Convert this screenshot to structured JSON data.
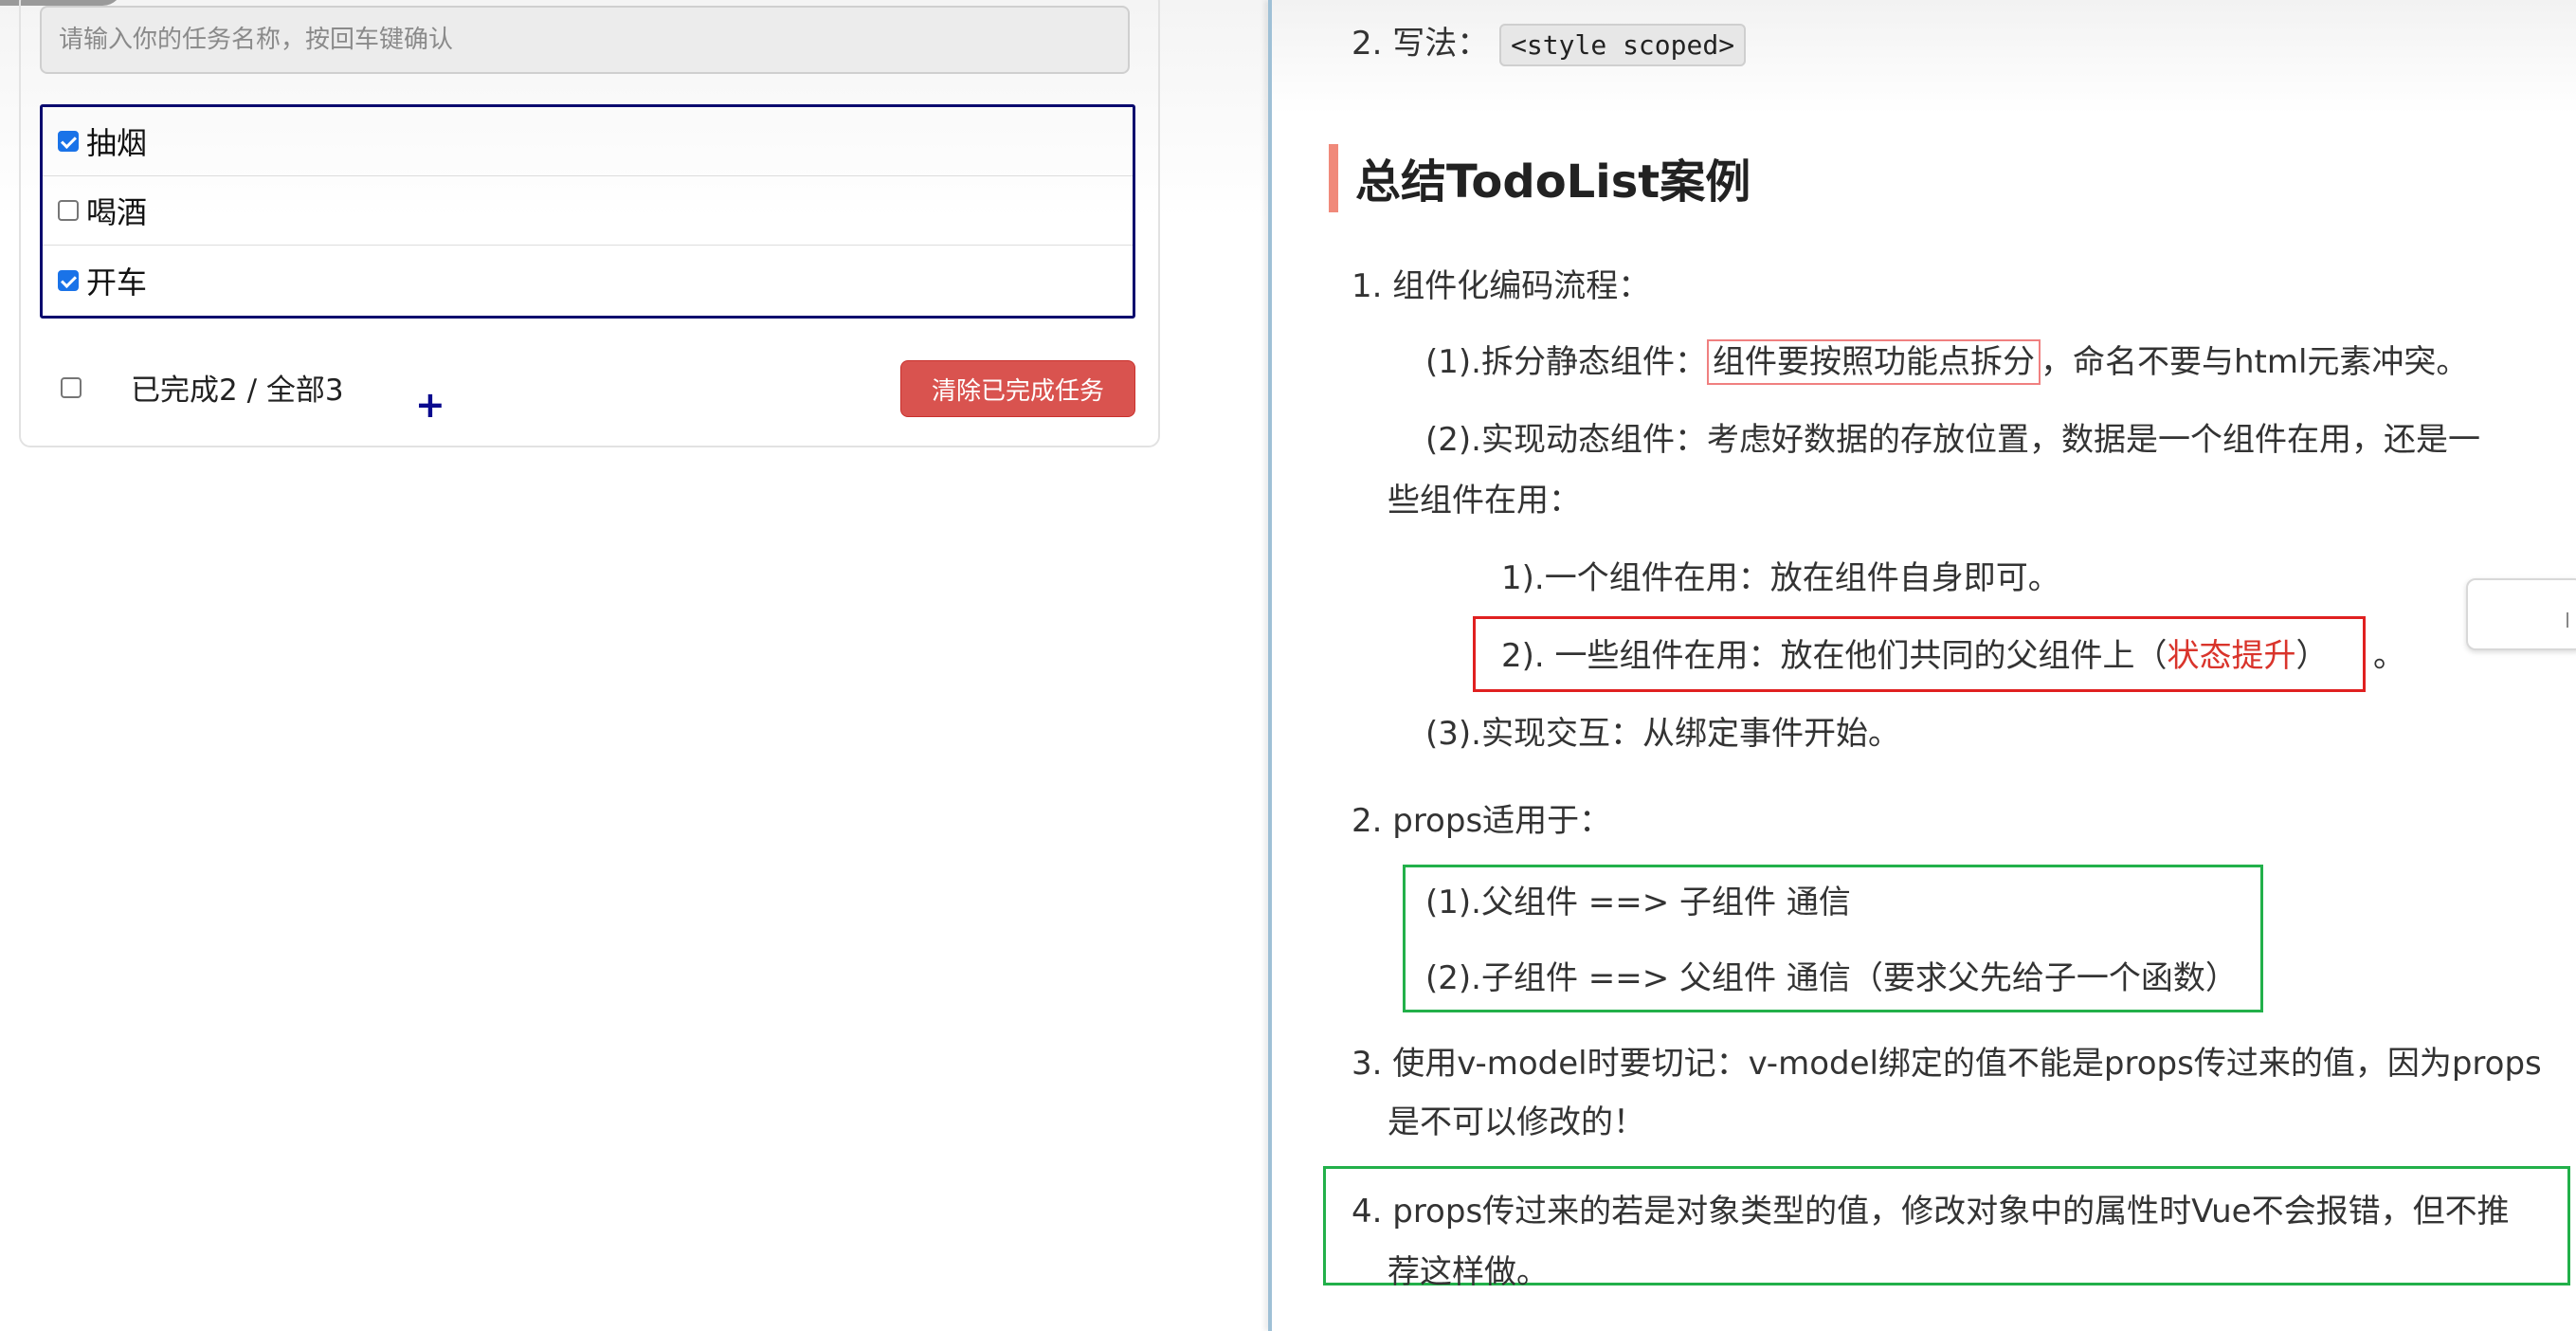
{
  "todo": {
    "input_placeholder": "请输入你的任务名称，按回车键确认",
    "items": [
      {
        "label": "抽烟",
        "done": true
      },
      {
        "label": "喝酒",
        "done": false
      },
      {
        "label": "开车",
        "done": true
      }
    ],
    "footer_status": "已完成2 / 全部3",
    "plus_glyph": "+",
    "clear_button": "清除已完成任务",
    "colors": {
      "list_border": "#0a0a6e",
      "button_bg": "#d9534f"
    }
  },
  "notes": {
    "top_line": {
      "prefix": "2. 写法：",
      "code": "<style scoped>"
    },
    "heading": "总结TodoList案例",
    "s1_title": "1. 组件化编码流程：",
    "s1_a_prefix": "(1).拆分静态组件：",
    "s1_a_boxed": "组件要按照功能点拆分",
    "s1_a_suffix": "，命名不要与html元素冲突。",
    "s1_b_line1": "(2).实现动态组件：考虑好数据的存放位置，数据是一个组件在用，还是一",
    "s1_b_line2": "些组件在用：",
    "s1_b_1": "1).一个组件在用：放在组件自身即可。",
    "s1_b_2_prefix": "2). 一些组件在用：放在他们共同的父组件上（",
    "s1_b_2_red": "状态提升",
    "s1_b_2_suffix": "）",
    "s1_b_2_tail": "。",
    "s1_c": "(3).实现交互：从绑定事件开始。",
    "s2_title": "2. props适用于：",
    "s2_a": "(1).父组件 ==> 子组件 通信",
    "s2_b": "(2).子组件 ==> 父组件 通信（要求父先给子一个函数）",
    "s3_line1": "3. 使用v-model时要切记：v-model绑定的值不能是props传过来的值，因为props",
    "s3_line2": "是不可以修改的！",
    "s4_line1": "4. props传过来的若是对象类型的值，修改对象中的属性时Vue不会报错，但不推",
    "s4_line2": "荐这样做。",
    "colors": {
      "heading_bar": "#f0897a",
      "red_box": "#e02020",
      "green_box": "#22b04a",
      "pink_box": "#f08080"
    }
  }
}
